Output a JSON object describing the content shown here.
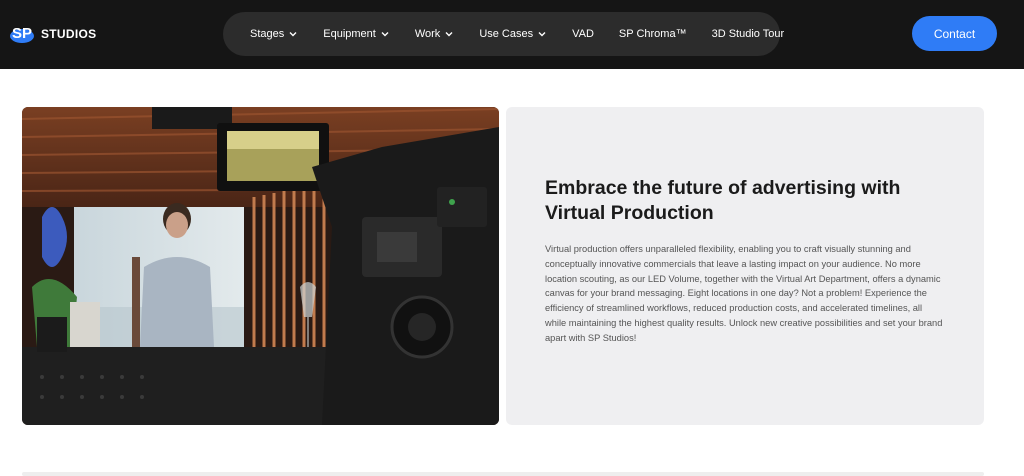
{
  "header": {
    "logo": {
      "mark": "SP",
      "word": "STUDIOS"
    },
    "nav": [
      {
        "label": "Stages",
        "dropdown": true
      },
      {
        "label": "Equipment",
        "dropdown": true
      },
      {
        "label": "Work",
        "dropdown": true
      },
      {
        "label": "Use Cases",
        "dropdown": true
      },
      {
        "label": "VAD",
        "dropdown": false
      },
      {
        "label": "SP Chroma™",
        "dropdown": false
      },
      {
        "label": "3D Studio Tour",
        "dropdown": false
      }
    ],
    "contact_label": "Contact"
  },
  "content": {
    "title": "Embrace the future of advertising with Virtual Production",
    "body": "Virtual production offers unparalleled flexibility, enabling you to craft visually stunning and conceptually innovative commercials that leave a lasting impact on your audience. No more location scouting, as our LED Volume, together with the Virtual Art Department, offers a dynamic canvas for your brand messaging. Eight locations in one day? Not a problem! Experience the efficiency of streamlined workflows, reduced production costs, and accelerated timelines, all while maintaining the highest quality results. Unlock new creative possibilities and set your brand apart with SP Studios!"
  },
  "colors": {
    "header_bg": "#151515",
    "nav_bg": "#2c2c2c",
    "accent": "#2f7cf6",
    "panel_bg": "#efeff1"
  }
}
